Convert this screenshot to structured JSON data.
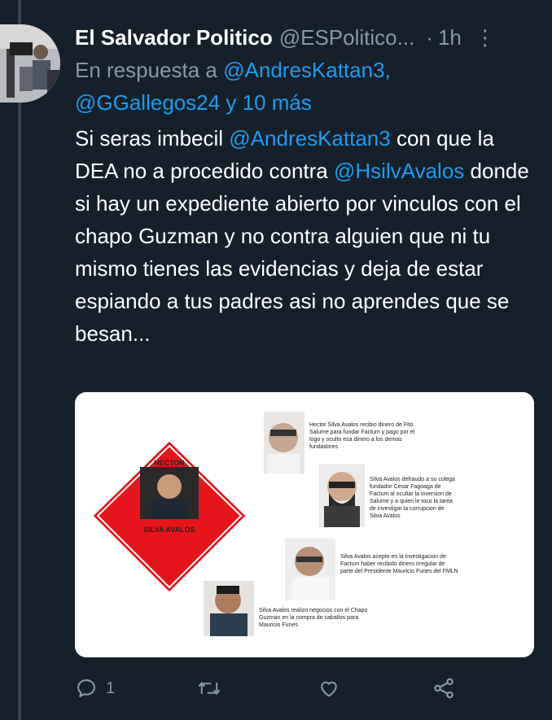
{
  "tweet": {
    "author_name": "El Salvador Politico",
    "handle": "@ESPolitico...",
    "separator": "·",
    "time": "1h",
    "reply_prefix": "En respuesta a",
    "reply_to_1": "@AndresKattan3,",
    "reply_to_2": "@GGallegos24",
    "reply_suffix": "y 10 más",
    "body_1": "Si seras imbecil",
    "body_mention_1": "@AndresKattan3",
    "body_2": "con que la DEA no a procedido contra",
    "body_mention_2": "@HsilvAvalos",
    "body_3": "donde si hay un expediente abierto por vinculos con el chapo Guzman y no contra alguien que ni tu mismo tienes las evidencias y deja de estar espiando a tus padres asi no aprendes que se besan..."
  },
  "media": {
    "badge_top": "HECTOR",
    "badge_bottom": "SILVA AVALOS",
    "caption_1": [
      "Hector Silva Avalos recibio dinero de Fito",
      "Salume para fundar Factum y pago por el",
      "logo y oculto esa dinero a los demas",
      "fundadores"
    ],
    "caption_2": [
      "Silva Avalos defraudo a su colega",
      "fundador Cesar Fagoaga de",
      "Factum  al ocultar la inversion de",
      "Salume y a quien le toco la tarea",
      "de investigar la corrupcion de",
      "Silva Avalos"
    ],
    "caption_3": [
      "Silva Avalos acepto en la investigacion de",
      "Factum haber recibido dinero irregular de",
      "parte del Presidente Mauricio Funes del FMLN"
    ],
    "caption_4": [
      "Silva Avalos realizo negocios con el Chapo",
      "Guzman en la compra de caballos para",
      "Mauricio Funes"
    ]
  },
  "actions": {
    "reply_count": "1",
    "icons": [
      "reply-icon",
      "retweet-icon",
      "like-icon",
      "share-icon"
    ]
  },
  "colors": {
    "background": "#15202b",
    "link": "#1d9bf0",
    "muted": "#8899a6",
    "badge_red": "#e8141c"
  }
}
